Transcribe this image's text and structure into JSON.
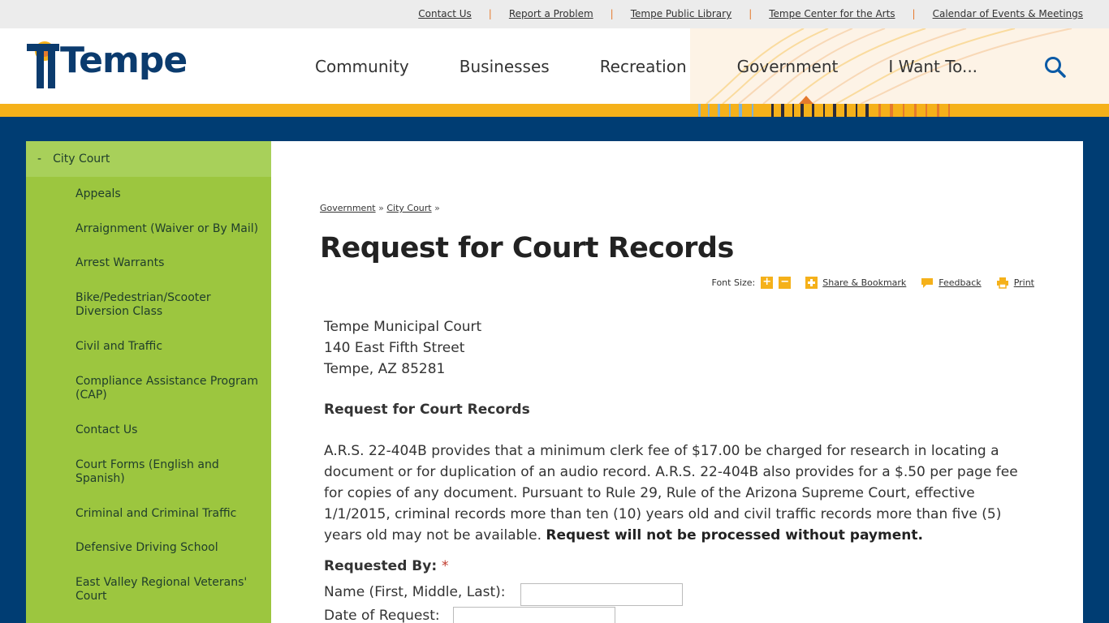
{
  "utility_links": [
    "Contact Us",
    "Report a Problem",
    "Tempe Public Library",
    "Tempe Center for the Arts",
    "Calendar of Events & Meetings"
  ],
  "brand": {
    "logo_text": "Tempe",
    "accent": "#f5b11a",
    "primary": "#003d73",
    "sidebar_green": "#9cc63f"
  },
  "nav": [
    "Community",
    "Businesses",
    "Recreation",
    "Government",
    "I Want To..."
  ],
  "sidebar": {
    "heading": "City Court",
    "items": [
      "Appeals",
      "Arraignment (Waiver or By Mail)",
      "Arrest Warrants",
      "Bike/Pedestrian/Scooter Diversion Class",
      "Civil and Traffic",
      "Compliance Assistance Program (CAP)",
      "Contact Us",
      "Court Forms (English and Spanish)",
      "Criminal and Criminal Traffic",
      "Defensive Driving School",
      "East Valley Regional Veterans' Court"
    ]
  },
  "breadcrumb": {
    "items": [
      "Government",
      "City Court"
    ],
    "sep": "»"
  },
  "page_title": "Request for Court Records",
  "tools": {
    "font_size": "Font Size:",
    "share": "Share & Bookmark",
    "feedback": "Feedback",
    "print": "Print"
  },
  "address": [
    "Tempe Municipal Court",
    "140 East Fifth Street",
    "Tempe, AZ 85281"
  ],
  "sub_heading": "Request for Court Records",
  "paragraph": {
    "text": "A.R.S. 22-404B provides that a minimum clerk fee of $17.00 be charged for research in locating a document or for duplication of an audio record. A.R.S. 22-404B also provides for a $.50 per page fee for copies of any document. Pursuant to Rule 29, Rule of the Arizona Supreme Court, effective 1/1/2015, criminal records more than ten (10) years old and civil traffic records more than five (5) years old may not be available. ",
    "bold": "Request will not be processed without payment."
  },
  "form": {
    "requested_by": "Requested By:",
    "required_mark": "*",
    "name_label": "Name (First, Middle, Last):",
    "name_value": "",
    "date_label": "Date of Request:",
    "date_value": ""
  }
}
